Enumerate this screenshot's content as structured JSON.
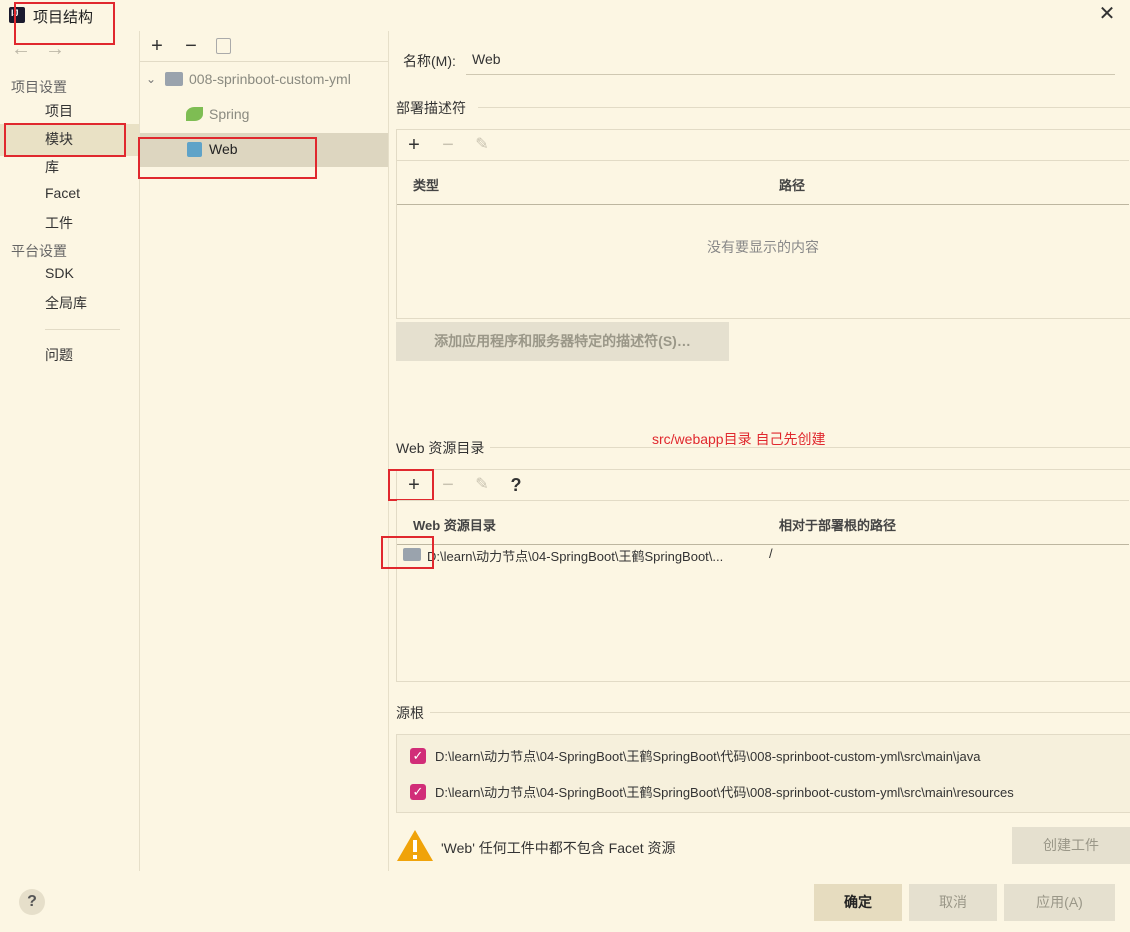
{
  "window": {
    "title": "项目结构"
  },
  "sidebar": {
    "project_settings_header": "项目设置",
    "items_project": [
      "项目",
      "模块",
      "库",
      "Facet",
      "工件"
    ],
    "platform_settings_header": "平台设置",
    "items_platform": [
      "SDK",
      "全局库"
    ],
    "problems": "问题"
  },
  "tree": {
    "root": "008-sprinboot-custom-yml",
    "children": [
      "Spring",
      "Web"
    ]
  },
  "detail": {
    "name_label": "名称(M):",
    "name_value": "Web",
    "deploy_section": "部署描述符",
    "deploy_col_type": "类型",
    "deploy_col_path": "路径",
    "deploy_empty": "没有要显示的内容",
    "deploy_add_button": "添加应用程序和服务器特定的描述符(S)…",
    "annotation": "src/webapp目录  自己先创建",
    "web_res_section": "Web 资源目录",
    "web_res_col_dir": "Web 资源目录",
    "web_res_col_rel": "相对于部署根的路径",
    "web_res_row_dir": "D:\\learn\\动力节点\\04-SpringBoot\\王鹤SpringBoot\\...",
    "web_res_row_rel": "/",
    "source_roots_section": "源根",
    "source_roots": [
      "D:\\learn\\动力节点\\04-SpringBoot\\王鹤SpringBoot\\代码\\008-sprinboot-custom-yml\\src\\main\\java",
      "D:\\learn\\动力节点\\04-SpringBoot\\王鹤SpringBoot\\代码\\008-sprinboot-custom-yml\\src\\main\\resources"
    ],
    "warning": "'Web' 任何工件中都不包含 Facet 资源",
    "create_artifact": "创建工件"
  },
  "footer": {
    "ok": "确定",
    "cancel": "取消",
    "apply": "应用(A)"
  },
  "colors": {
    "bg": "#fcf6e3",
    "selection": "#e9e1c5",
    "annotation_red": "#e0282e",
    "checkbox": "#d12d78"
  }
}
